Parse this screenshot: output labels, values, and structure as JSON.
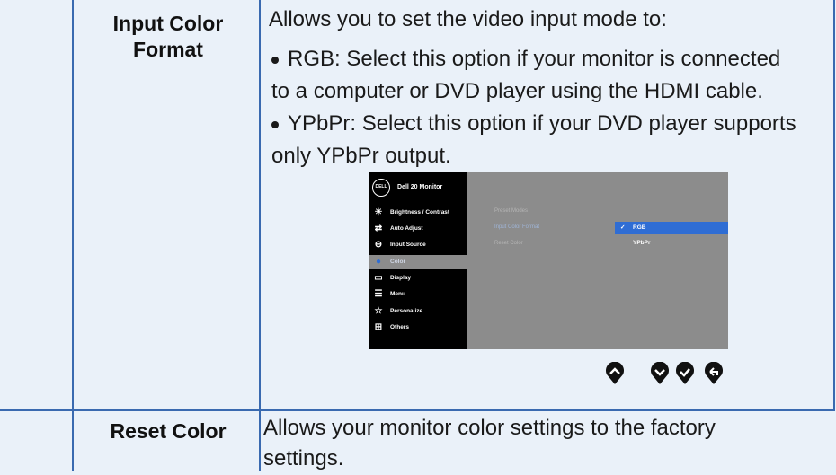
{
  "rows": [
    {
      "label": "Input Color Format",
      "intro": "Allows you to set the video input mode to:",
      "bullets": [
        {
          "line1": "RGB: Select this option if your monitor is connected",
          "line2": "to a computer or DVD player using the HDMI cable."
        },
        {
          "line1": "YPbPr: Select this option if your DVD player supports",
          "line2": "only YPbPr output."
        }
      ]
    },
    {
      "label": "Reset Color",
      "desc_line1": "Allows your monitor color settings to the factory",
      "desc_line2": "settings."
    }
  ],
  "osd": {
    "logo": "DELL",
    "title": "Dell 20 Monitor",
    "menu": [
      {
        "label": "Brightness / Contrast",
        "icon": "brightness-icon"
      },
      {
        "label": "Auto Adjust",
        "icon": "auto-adjust-icon"
      },
      {
        "label": "Input Source",
        "icon": "input-source-icon"
      },
      {
        "label": "Color",
        "icon": "color-icon",
        "selected": true
      },
      {
        "label": "Display",
        "icon": "display-icon"
      },
      {
        "label": "Menu",
        "icon": "menu-icon"
      },
      {
        "label": "Personalize",
        "icon": "personalize-icon"
      },
      {
        "label": "Others",
        "icon": "others-icon"
      }
    ],
    "submenu": [
      "Preset Modes",
      "Input Color Format",
      "Reset Color"
    ],
    "options": [
      "RGB",
      "YPbPr"
    ],
    "selected_option": "RGB",
    "colors": {
      "osd_bg": "#8c8c8c",
      "menu_bg": "#000000",
      "highlight": "#2f6dd4"
    }
  },
  "nav_buttons": [
    "up-button",
    "down-button",
    "ok-button",
    "back-button"
  ]
}
